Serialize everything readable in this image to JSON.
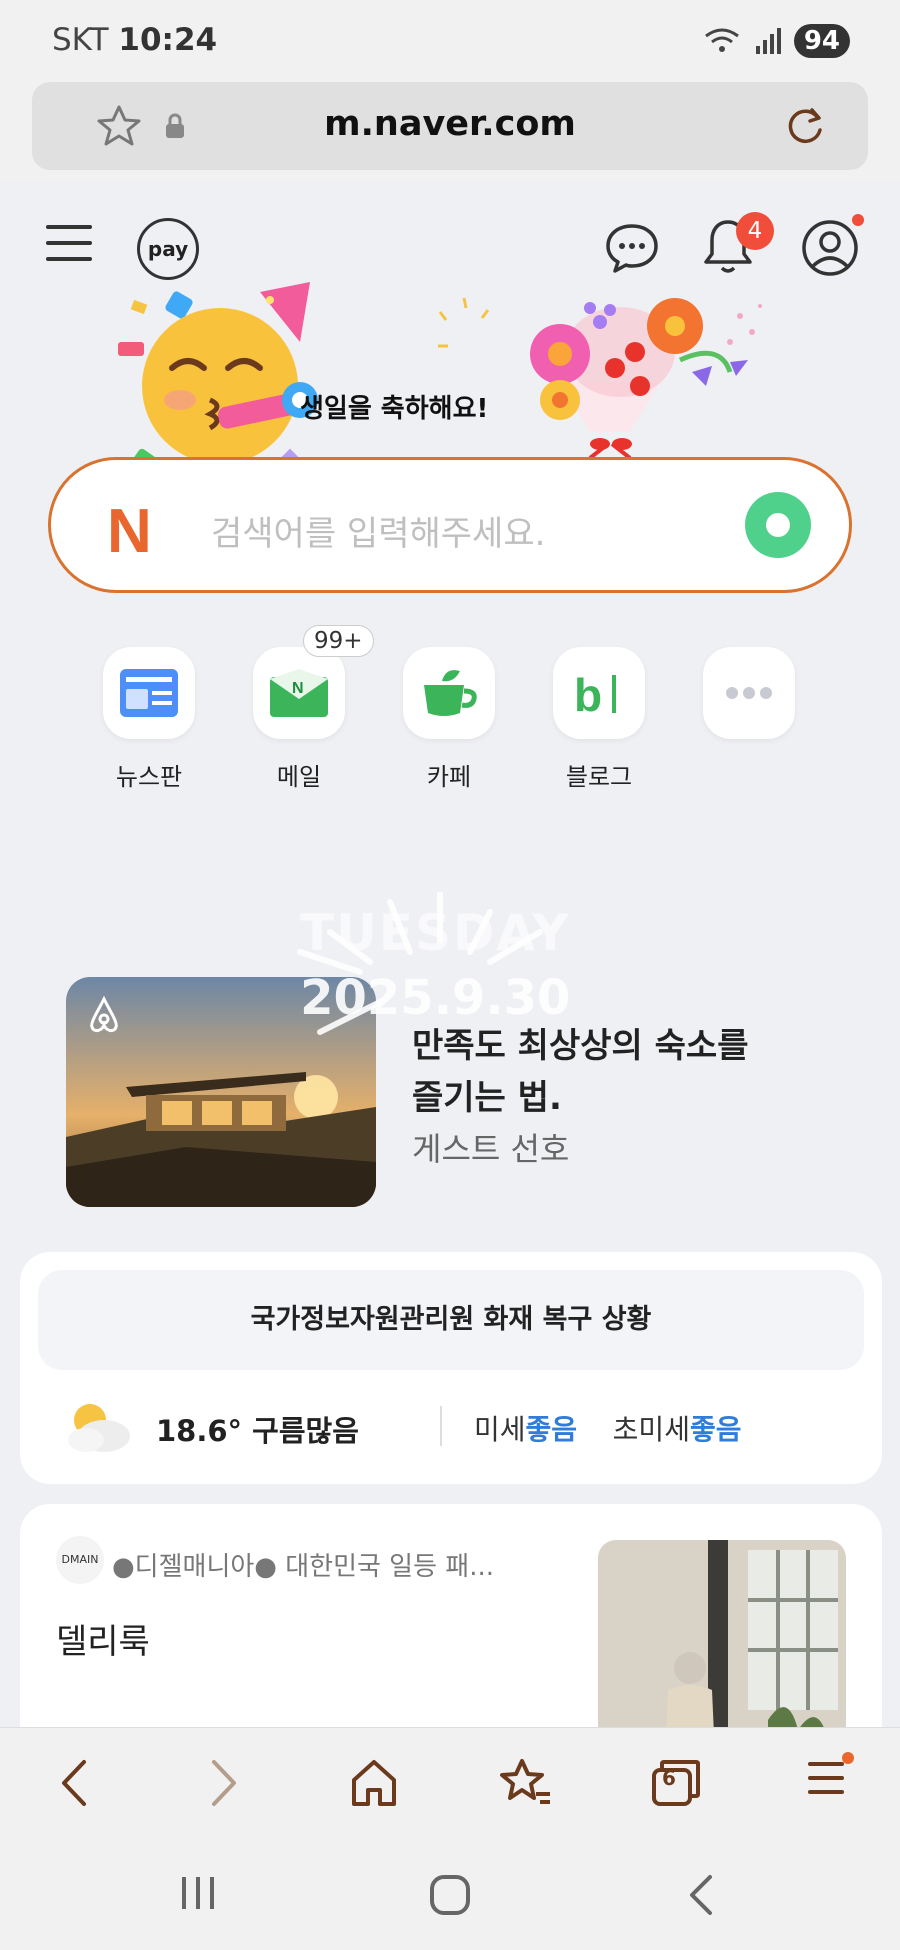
{
  "status_bar": {
    "carrier": "SKT",
    "time": "10:24",
    "battery": "94"
  },
  "browser": {
    "url": "m.naver.com",
    "tab_count": "6"
  },
  "header": {
    "pay_label": "pay",
    "notification_count": "4"
  },
  "birthday": {
    "message": "생일을 축하해요!"
  },
  "search": {
    "placeholder": "검색어를 입력해주세요."
  },
  "quick_links": [
    {
      "label": "뉴스판"
    },
    {
      "label": "메일",
      "badge": "99+"
    },
    {
      "label": "카페"
    },
    {
      "label": "블로그"
    },
    {
      "label": ""
    }
  ],
  "date_overlay": {
    "day": "TUESDAY",
    "date": "2025.9.30"
  },
  "ad": {
    "title_line1": "만족도 최상상의 숙소를",
    "title_line2": "즐기는 법.",
    "subtitle": "게스트 선호"
  },
  "info_card": {
    "notice": "국가정보자원관리원 화재 복구 상황",
    "temperature": "18.6° 구름많음",
    "fine_dust_label": "미세",
    "fine_dust_value": "좋음",
    "ultra_dust_label": "초미세",
    "ultra_dust_value": "좋음"
  },
  "feed": {
    "source_logo": "DMAIN",
    "source_text": "●디젤매니아● 대한민국 일등 패...",
    "title": "델리룩"
  },
  "colors": {
    "naver_orange": "#e9672e",
    "search_green": "#4fd18b",
    "good_blue": "#2f7cd9",
    "badge_red": "#f04d3a"
  }
}
